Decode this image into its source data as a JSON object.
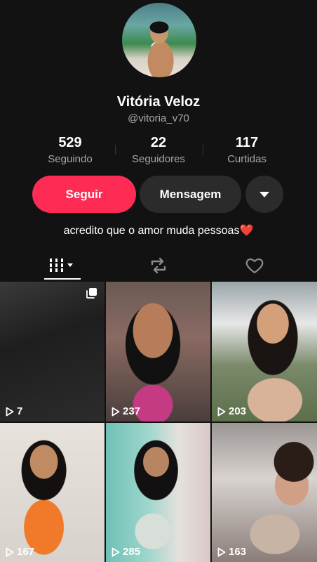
{
  "profile": {
    "name": "Vitória Veloz",
    "handle": "@vitoria_v70",
    "bio": "acredito que o amor muda pessoas",
    "bio_emoji": "❤️"
  },
  "stats": [
    {
      "value": "529",
      "label": "Seguindo"
    },
    {
      "value": "22",
      "label": "Seguidores"
    },
    {
      "value": "117",
      "label": "Curtidas"
    }
  ],
  "actions": {
    "follow_label": "Seguir",
    "message_label": "Mensagem",
    "more_icon": "caret-down-icon"
  },
  "tabs": [
    {
      "name": "videos",
      "icon": "grid-icon",
      "active": true
    },
    {
      "name": "reposts",
      "icon": "repost-icon",
      "active": false
    },
    {
      "name": "liked",
      "icon": "heart-outline-icon",
      "active": false
    }
  ],
  "videos": [
    {
      "views": "7",
      "multi": true
    },
    {
      "views": "237",
      "multi": false
    },
    {
      "views": "203",
      "multi": false
    },
    {
      "views": "167",
      "multi": false
    },
    {
      "views": "285",
      "multi": false
    },
    {
      "views": "163",
      "multi": false
    }
  ],
  "colors": {
    "background": "#121212",
    "accent": "#fe2c55",
    "secondary_button": "#2b2b2b",
    "muted_text": "#a8a8a8"
  }
}
